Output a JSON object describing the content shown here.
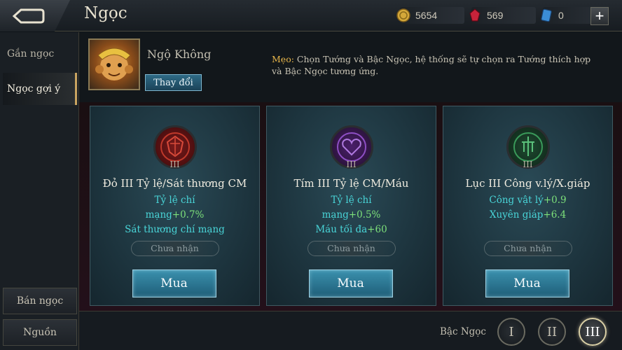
{
  "header": {
    "title": "Ngọc",
    "back_icon": "back-arrow-icon",
    "currencies": [
      {
        "icon": "gold-coin-icon",
        "value": "5654"
      },
      {
        "icon": "red-gem-icon",
        "value": "569"
      },
      {
        "icon": "blue-voucher-icon",
        "value": "0"
      }
    ],
    "plus_label": "+"
  },
  "sidebar": {
    "tabs": [
      {
        "label": "Gắn ngọc"
      },
      {
        "label": "Ngọc gợi ý"
      }
    ],
    "sell_label": "Bán ngọc",
    "source_label": "Nguồn"
  },
  "hero": {
    "name": "Ngộ Không",
    "change_label": "Thay đổi",
    "tip_label": "Mẹo:",
    "tip_text": " Chọn Tướng và Bậc Ngọc, hệ thống sẽ tự chọn ra Tướng thích hợp và Bậc Ngọc tương ứng."
  },
  "cards": [
    {
      "color": "#b8322e",
      "icon": "red-gem-emblem-icon",
      "level": "III",
      "name": "Đỏ III Tỷ lệ/Sát thương CM",
      "stats": [
        {
          "label": "Tỷ lệ chí",
          "value": ""
        },
        {
          "label": "mạng",
          "value": "+0.7%"
        },
        {
          "label": "Sát thương chí mạng",
          "value": ""
        }
      ],
      "owned": "Chưa nhận",
      "buy": "Mua"
    },
    {
      "color": "#8e4fc4",
      "icon": "purple-gem-emblem-icon",
      "level": "III",
      "name": "Tím III Tỷ lệ CM/Máu",
      "stats": [
        {
          "label": "Tỷ lệ chí",
          "value": ""
        },
        {
          "label": "mạng",
          "value": "+0.5%"
        },
        {
          "label": "Máu tối đa",
          "value": "+60"
        }
      ],
      "owned": "Chưa nhận",
      "buy": "Mua"
    },
    {
      "color": "#3a9a5a",
      "icon": "green-gem-emblem-icon",
      "level": "III",
      "name": "Lục III Công v.lý/X.giáp",
      "stats": [
        {
          "label": "Công vật lý",
          "value": "+0.9"
        },
        {
          "label": "Xuyên giáp",
          "value": "+6.4"
        }
      ],
      "owned": "Chưa nhận",
      "buy": "Mua"
    }
  ],
  "footer": {
    "rank_label": "Bậc Ngọc",
    "ranks": [
      "I",
      "II",
      "III"
    ],
    "active_rank": "III"
  }
}
